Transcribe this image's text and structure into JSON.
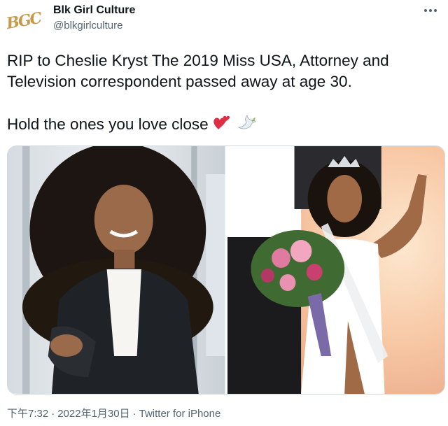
{
  "author": {
    "display_name": "Blk Girl Culture",
    "handle": "@blkgirlculture",
    "avatar_logo": "BGC"
  },
  "tweet": {
    "line1": "RIP to Cheslie Kryst The 2019 Miss USA, Attorney and Television correspondent passed away at age 30.",
    "line2": "Hold the ones you love close",
    "emojis": [
      "two-hearts-icon",
      "dove-icon"
    ]
  },
  "footer": {
    "time": "下午7:32",
    "date": "2022年1月30日",
    "source": "Twitter for iPhone",
    "separator": "·"
  },
  "colors": {
    "text": "#0f1419",
    "secondary": "#536471",
    "border": "#cfd9de",
    "logo_gold": "#c69a4a"
  }
}
